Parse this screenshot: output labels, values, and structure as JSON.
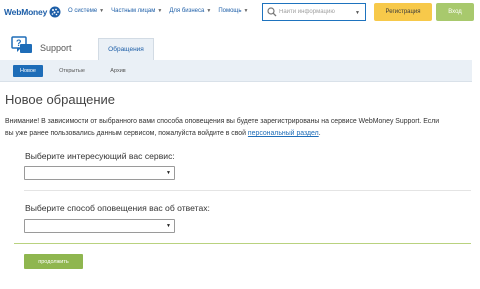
{
  "header": {
    "logo_text": "WebMoney",
    "nav": [
      {
        "label": "О системе"
      },
      {
        "label": "Частным лицам"
      },
      {
        "label": "Для бизнеса"
      },
      {
        "label": "Помощь"
      }
    ],
    "search": {
      "placeholder": "Найти информацию",
      "value": ""
    },
    "register_label": "Регистрация",
    "login_label": "Вход",
    "colors": {
      "brand_blue": "#1e5fa8",
      "register_bg": "#f7c94a",
      "login_bg": "#a8c96d"
    }
  },
  "support": {
    "title": "Support",
    "main_tab": "Обращения",
    "sub_tabs": [
      {
        "label": "Новое",
        "active": true
      },
      {
        "label": "Открытые",
        "active": false
      },
      {
        "label": "Архив",
        "active": false
      }
    ]
  },
  "content": {
    "title": "Новое обращение",
    "notice_line1": "Внимание! В зависимости от выбранного вами способа оповещения вы будете зарегистрированы на сервисе WebMoney Support. Если",
    "notice_line2": "вы уже ранее пользовались данным сервисом, пожалуйста войдите в свой ",
    "notice_link": "персональный раздел",
    "notice_end": ".",
    "service_label": "Выберите интересующий вас сервис:",
    "service_value": "",
    "notify_label": "Выберите способ оповещения вас об ответах:",
    "notify_value": "",
    "continue_label": "продолжить",
    "colors": {
      "accent_green": "#8fb64f",
      "active_tab": "#1e6db8"
    }
  }
}
